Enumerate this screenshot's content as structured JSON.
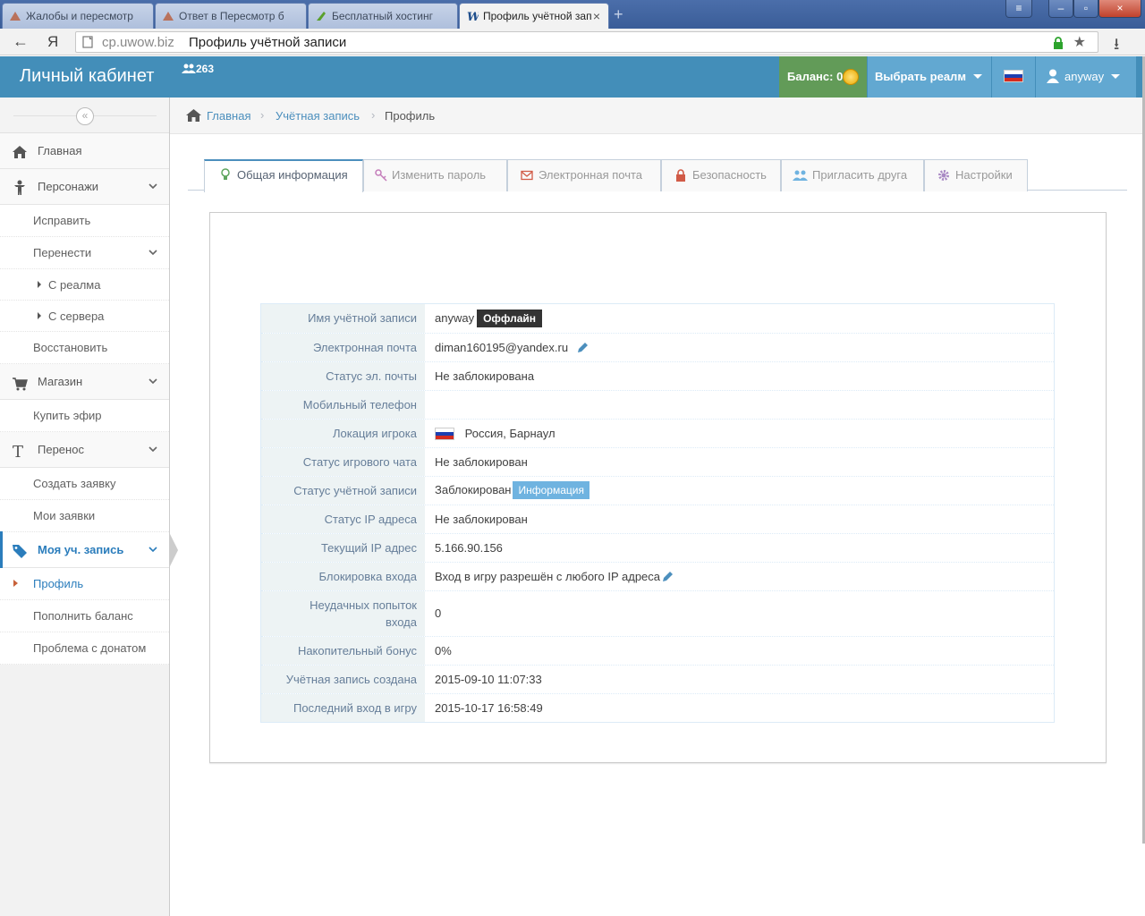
{
  "browser": {
    "tabs": [
      {
        "label": "Жалобы и пересмотр"
      },
      {
        "label": "Ответ в Пересмотр б"
      },
      {
        "label": "Бесплатный хостинг"
      },
      {
        "label": "Профиль учётной зап"
      }
    ],
    "url_host": "cp.uwow.biz",
    "url_title": "Профиль учётной записи"
  },
  "header": {
    "brand": "Личный кабинет",
    "online_count": "263",
    "balance_label": "Баланс: 0",
    "realm_label": "Выбрать реалм",
    "username": "anyway"
  },
  "sidebar": {
    "home": "Главная",
    "characters": "Персонажи",
    "fix": "Исправить",
    "transfer_move": "Перенести",
    "from_realm": "С реалма",
    "from_server": "С сервера",
    "restore": "Восстановить",
    "shop": "Магазин",
    "buy_ether": "Купить эфир",
    "transfer": "Перенос",
    "create_request": "Создать заявку",
    "my_requests": "Мои заявки",
    "my_account": "Моя уч. запись",
    "profile": "Профиль",
    "topup": "Пополнить баланс",
    "donate_problem": "Проблема с донатом"
  },
  "breadcrumbs": {
    "home": "Главная",
    "account": "Учётная запись",
    "current": "Профиль"
  },
  "tabs": {
    "general": "Общая информация",
    "password": "Изменить пароль",
    "email": "Электронная почта",
    "security": "Безопасность",
    "invite": "Пригласить друга",
    "settings": "Настройки"
  },
  "profile": {
    "rows": [
      {
        "name": "Имя учётной записи",
        "value": "anyway",
        "badge": "Оффлайн"
      },
      {
        "name": "Электронная почта",
        "value": "diman160195@yandex.ru"
      },
      {
        "name": "Статус эл. почты",
        "value": "Не заблокирована"
      },
      {
        "name": "Мобильный телефон",
        "value": ""
      },
      {
        "name": "Локация игрока",
        "value": "Россия, Барнаул"
      },
      {
        "name": "Статус игрового чата",
        "value": "Не заблокирован"
      },
      {
        "name": "Статус учётной записи",
        "value": "Заблокирован",
        "badge": "Информация"
      },
      {
        "name": "Статус IP адреса",
        "value": "Не заблокирован"
      },
      {
        "name": "Текущий IP адрес",
        "value": "5.166.90.156"
      },
      {
        "name": "Блокировка входа",
        "value": "Вход в игру разрешён с любого IP адреса"
      },
      {
        "name": "Неудачных попыток входа",
        "value": "0"
      },
      {
        "name": "Накопительный бонус",
        "value": "0%"
      },
      {
        "name": "Учётная запись создана",
        "value": "2015-09-10 11:07:33"
      },
      {
        "name": "Последний вход в игру",
        "value": "2015-10-17 16:58:49"
      }
    ]
  },
  "colors": {
    "header_bg": "#438eb9",
    "balance_bg": "#629b58",
    "nav_bg": "#62a8d1",
    "link": "#4c8fbd",
    "active": "#2b7dbc"
  }
}
